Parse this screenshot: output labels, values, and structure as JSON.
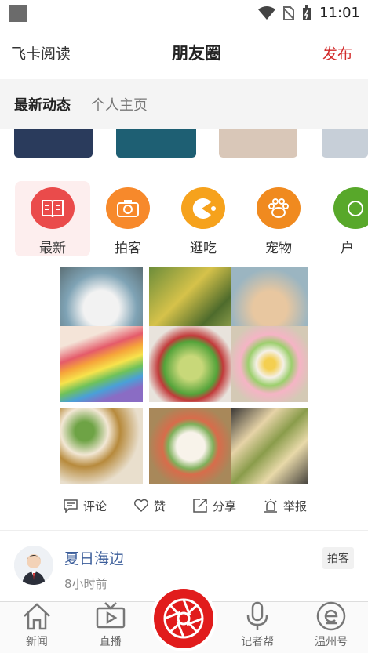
{
  "status_bar": {
    "time": "11:01",
    "icons": [
      "wifi-icon",
      "no-sim-icon",
      "battery-icon"
    ]
  },
  "header": {
    "left_label": "飞卡阅读",
    "title": "朋友圈",
    "right_label": "发布"
  },
  "tabs": [
    {
      "label": "最新动态",
      "active": true
    },
    {
      "label": "个人主页",
      "active": false
    }
  ],
  "categories": [
    {
      "label": "最新",
      "icon": "book-icon",
      "color": "#ea4b4b"
    },
    {
      "label": "拍客",
      "icon": "camera-icon",
      "color": "#f7892b"
    },
    {
      "label": "逛吃",
      "icon": "pacman-icon",
      "color": "#f6a21c"
    },
    {
      "label": "宠物",
      "icon": "paw-icon",
      "color": "#f08a1f"
    },
    {
      "label": "户",
      "icon": "outdoor-icon",
      "color": "#58a82a"
    }
  ],
  "actions": {
    "comment": "评论",
    "like": "赞",
    "share": "分享",
    "report": "举报"
  },
  "post": {
    "author": "夏日海边",
    "time": "8小时前",
    "badge": "拍客"
  },
  "bottom_nav": [
    {
      "label": "新闻"
    },
    {
      "label": "直播"
    },
    {
      "label": ""
    },
    {
      "label": "记者帮"
    },
    {
      "label": "温州号"
    }
  ],
  "colors": {
    "accent": "#d22c2c",
    "link": "#3b5d9a"
  }
}
